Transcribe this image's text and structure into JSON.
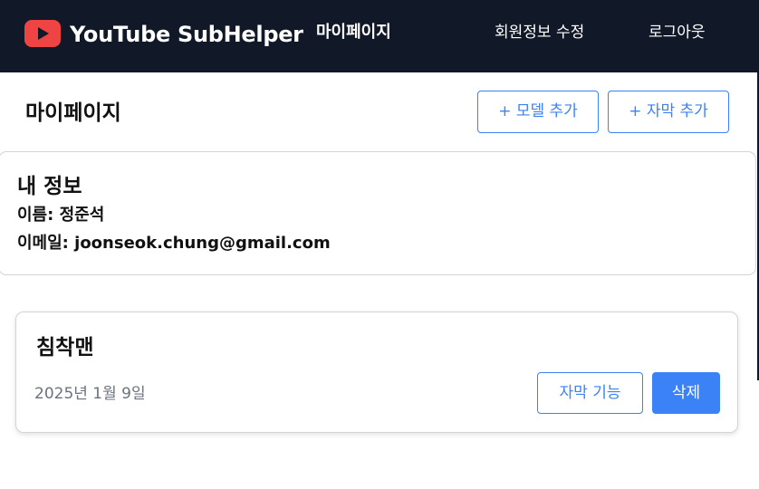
{
  "navbar": {
    "brand": "YouTube SubHelper",
    "links": [
      "마이페이지",
      "회원정보 수정",
      "로그아웃"
    ],
    "logo_icon": "youtube-play-icon",
    "background": "#111827",
    "logo_color": "#ef4444"
  },
  "page": {
    "title": "마이페이지",
    "buttons": {
      "add_model": "+ 모델 추가",
      "add_subtitle": "+ 자막 추가"
    }
  },
  "profile": {
    "heading": "내 정보",
    "name_line": "이름: 정준석",
    "email_line": "이메일: joonseok.chung@gmail.com"
  },
  "models": [
    {
      "name": "침착맨",
      "date": "2025년 1월 9일",
      "subtitle_button": "자막 기능",
      "delete_button": "삭제"
    }
  ],
  "colors": {
    "accent": "#3b82f6",
    "muted": "#6b7280",
    "border": "#d1d5db"
  }
}
